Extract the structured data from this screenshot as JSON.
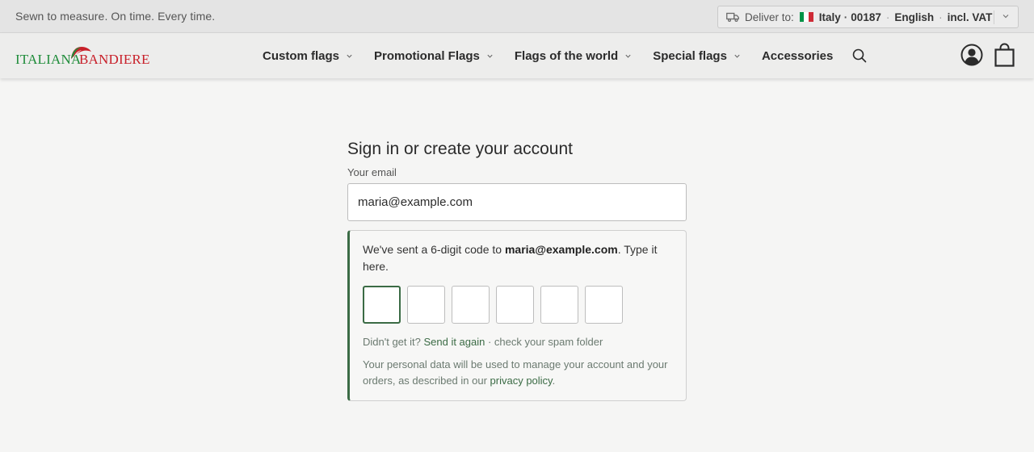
{
  "topbar": {
    "tagline": "Sewn to measure. On time. Every time.",
    "locale": {
      "deliver_label": "Deliver to:",
      "country": "Italy",
      "postcode": "00187",
      "language": "English",
      "tax": "incl. VAT",
      "truck_icon": "truck-icon",
      "flag_colors": [
        "#009246",
        "#ffffff",
        "#ce2b37"
      ]
    }
  },
  "header": {
    "logo": {
      "word1": "ITALIANA",
      "word2": "BANDIERE",
      "green": "#1f8c3a",
      "red": "#c8202a"
    },
    "nav": [
      {
        "label": "Custom flags",
        "has_dropdown": true
      },
      {
        "label": "Promotional Flags",
        "has_dropdown": true
      },
      {
        "label": "Flags of the world",
        "has_dropdown": true
      },
      {
        "label": "Special flags",
        "has_dropdown": true
      },
      {
        "label": "Accessories",
        "has_dropdown": false
      }
    ],
    "icons": {
      "search": "search-icon",
      "account": "account-icon",
      "cart": "shopping-bag-icon"
    }
  },
  "signin": {
    "title": "Sign in or create your account",
    "email_label": "Your email",
    "email_value": "maria@example.com",
    "code_message_prefix": "We've sent a 6-digit code to ",
    "code_message_email": "maria@example.com",
    "code_message_suffix": ". Type it here.",
    "code_digits": [
      "",
      "",
      "",
      "",
      "",
      ""
    ],
    "resend_prefix": "Didn't get it? ",
    "resend_link": "Send it again",
    "resend_suffix": " · check your spam folder",
    "privacy_text": "Your personal data will be used to manage your account and your orders, as described in our ",
    "privacy_link": "privacy policy",
    "privacy_end": ".",
    "accent_color": "#3b6b45"
  }
}
